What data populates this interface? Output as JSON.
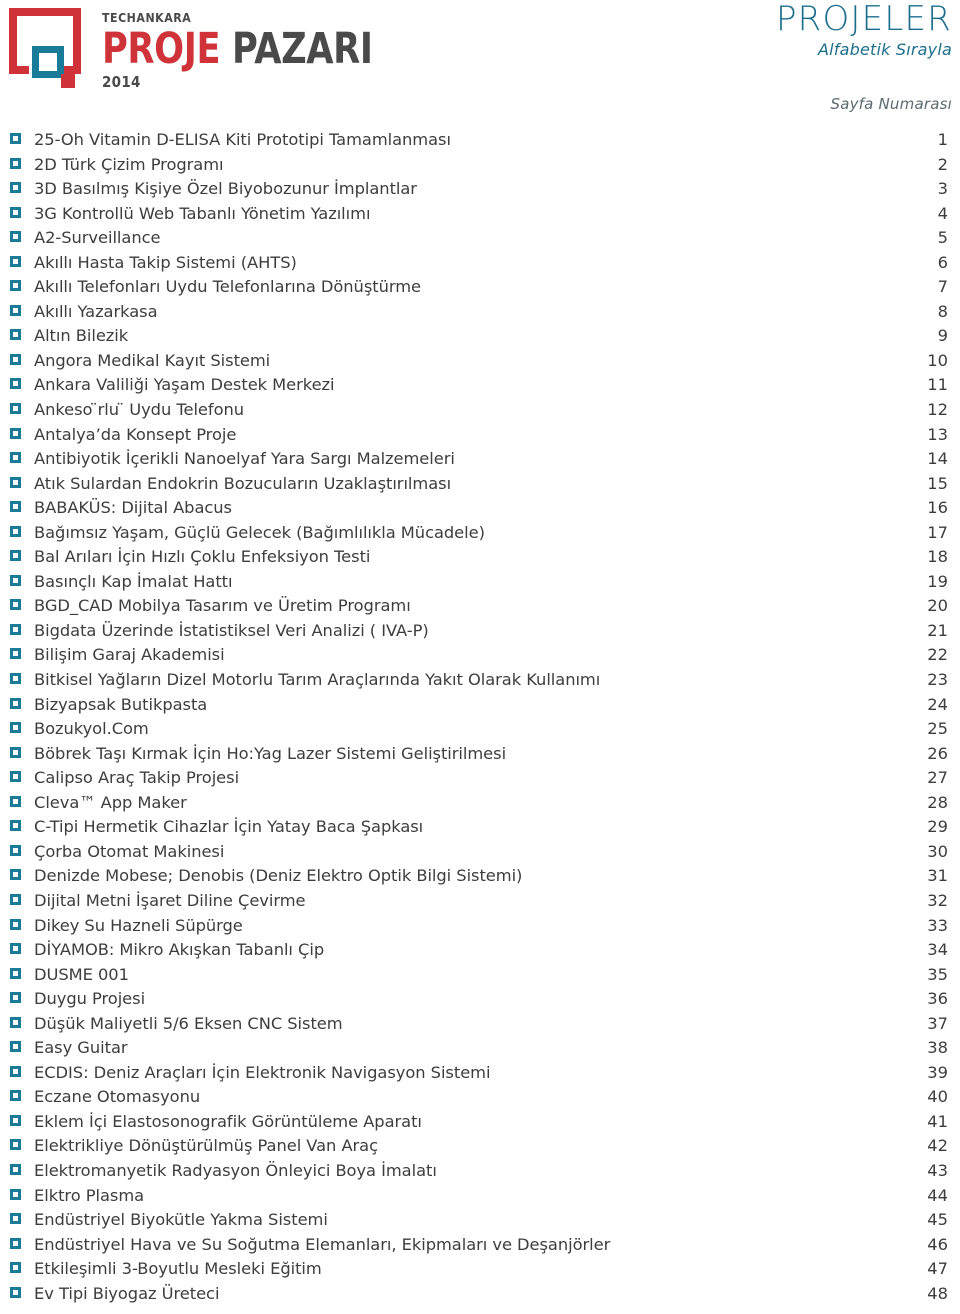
{
  "header": {
    "logo": {
      "mark_name": "proje-pazari-square-logo",
      "top_text": "TECHANKARA",
      "main_text_red": "PROJE",
      "main_text_gray": "PAZARI",
      "year": "2014"
    },
    "title": "PROJELER",
    "subtitle": "Alfabetik Sırayla",
    "page_column_label": "Sayfa Numarası"
  },
  "colors": {
    "teal": "#1a7b99",
    "title_teal": "#1a6e8c",
    "red": "#cf3339",
    "text_gray": "#3d3d3d",
    "logo_gray": "#4a4a4a"
  },
  "list": {
    "bullet_icon": "checkbox-square-icon",
    "items": [
      {
        "label": "25-Oh Vitamin D-ELISA Kiti Prototipi Tamamlanması",
        "page": "1"
      },
      {
        "label": "2D Türk Çizim Programı",
        "page": "2"
      },
      {
        "label": "3D Basılmış Kişiye Özel Biyobozunur İmplantlar",
        "page": "3"
      },
      {
        "label": "3G Kontrollü Web Tabanlı Yönetim Yazılımı",
        "page": "4"
      },
      {
        "label": "A2-Surveillance",
        "page": "5"
      },
      {
        "label": "Akıllı Hasta Takip Sistemi (AHTS)",
        "page": "6"
      },
      {
        "label": "Akıllı Telefonları Uydu Telefonlarına Dönüştürme",
        "page": "7"
      },
      {
        "label": "Akıllı Yazarkasa",
        "page": "8"
      },
      {
        "label": "Altın Bilezik",
        "page": "9"
      },
      {
        "label": "Angora Medikal Kayıt Sistemi",
        "page": "10"
      },
      {
        "label": "Ankara Valiliği Yaşam Destek Merkezi",
        "page": "11"
      },
      {
        "label": "Ankeso ̈rlu ̈ Uydu Telefonu",
        "page": "12"
      },
      {
        "label": "Antalya’da Konsept Proje",
        "page": "13"
      },
      {
        "label": "Antibiyotik İçerikli Nanoelyaf Yara Sargı Malzemeleri",
        "page": "14"
      },
      {
        "label": "Atık Sulardan Endokrin Bozucuların Uzaklaştırılması",
        "page": "15"
      },
      {
        "label": "BABAKÜS: Dijital Abacus",
        "page": "16"
      },
      {
        "label": "Bağımsız Yaşam, Güçlü Gelecek (Bağımlılıkla Mücadele)",
        "page": "17"
      },
      {
        "label": "Bal Arıları İçin Hızlı Çoklu Enfeksiyon Testi",
        "page": "18"
      },
      {
        "label": "Basınçlı Kap İmalat Hattı",
        "page": "19"
      },
      {
        "label": "BGD_CAD Mobilya Tasarım ve Üretim Programı",
        "page": "20"
      },
      {
        "label": "Bigdata Üzerinde İstatistiksel Veri Analizi ( IVA-P)",
        "page": "21"
      },
      {
        "label": "Bilişim Garaj Akademisi",
        "page": "22"
      },
      {
        "label": "Bitkisel Yağların Dizel Motorlu Tarım Araçlarında Yakıt Olarak Kullanımı",
        "page": "23"
      },
      {
        "label": "Bizyapsak Butikpasta",
        "page": "24"
      },
      {
        "label": "Bozukyol.Com",
        "page": "25"
      },
      {
        "label": "Böbrek Taşı Kırmak İçin Ho:Yag Lazer Sistemi Geliştirilmesi",
        "page": "26"
      },
      {
        "label": "Calipso Araç Takip Projesi",
        "page": "27"
      },
      {
        "label": "Cleva™ App Maker",
        "page": "28"
      },
      {
        "label": "C-Tipi Hermetik Cihazlar İçin Yatay Baca Şapkası",
        "page": "29"
      },
      {
        "label": "Çorba Otomat Makinesi",
        "page": "30"
      },
      {
        "label": "Denizde Mobese; Denobis (Deniz Elektro Optik Bilgi Sistemi)",
        "page": "31"
      },
      {
        "label": "Dijital Metni İşaret Diline Çevirme",
        "page": "32"
      },
      {
        "label": "Dikey Su Hazneli Süpürge",
        "page": "33"
      },
      {
        "label": "DİYAMOB: Mikro Akışkan Tabanlı Çip",
        "page": "34"
      },
      {
        "label": "DUSME 001",
        "page": "35"
      },
      {
        "label": "Duygu Projesi",
        "page": "36"
      },
      {
        "label": "Düşük Maliyetli 5/6 Eksen CNC Sistem",
        "page": "37"
      },
      {
        "label": "Easy Guitar",
        "page": "38"
      },
      {
        "label": "ECDIS: Deniz Araçları İçin Elektronik Navigasyon Sistemi",
        "page": "39"
      },
      {
        "label": "Eczane Otomasyonu",
        "page": "40"
      },
      {
        "label": "Eklem İçi Elastosonografik Görüntüleme Aparatı",
        "page": "41"
      },
      {
        "label": "Elektrikliye Dönüştürülmüş Panel Van Araç",
        "page": "42"
      },
      {
        "label": "Elektromanyetik Radyasyon Önleyici Boya İmalatı",
        "page": "43"
      },
      {
        "label": "Elktro Plasma",
        "page": "44"
      },
      {
        "label": "Endüstriyel Biyokütle Yakma Sistemi",
        "page": "45"
      },
      {
        "label": "Endüstriyel Hava ve Su Soğutma Elemanları, Ekipmaları ve Deşanjörler",
        "page": "46"
      },
      {
        "label": "Etkileşimli 3-Boyutlu Mesleki Eğitim",
        "page": "47"
      },
      {
        "label": "Ev Tipi Biyogaz Üreteci",
        "page": "48"
      }
    ]
  }
}
